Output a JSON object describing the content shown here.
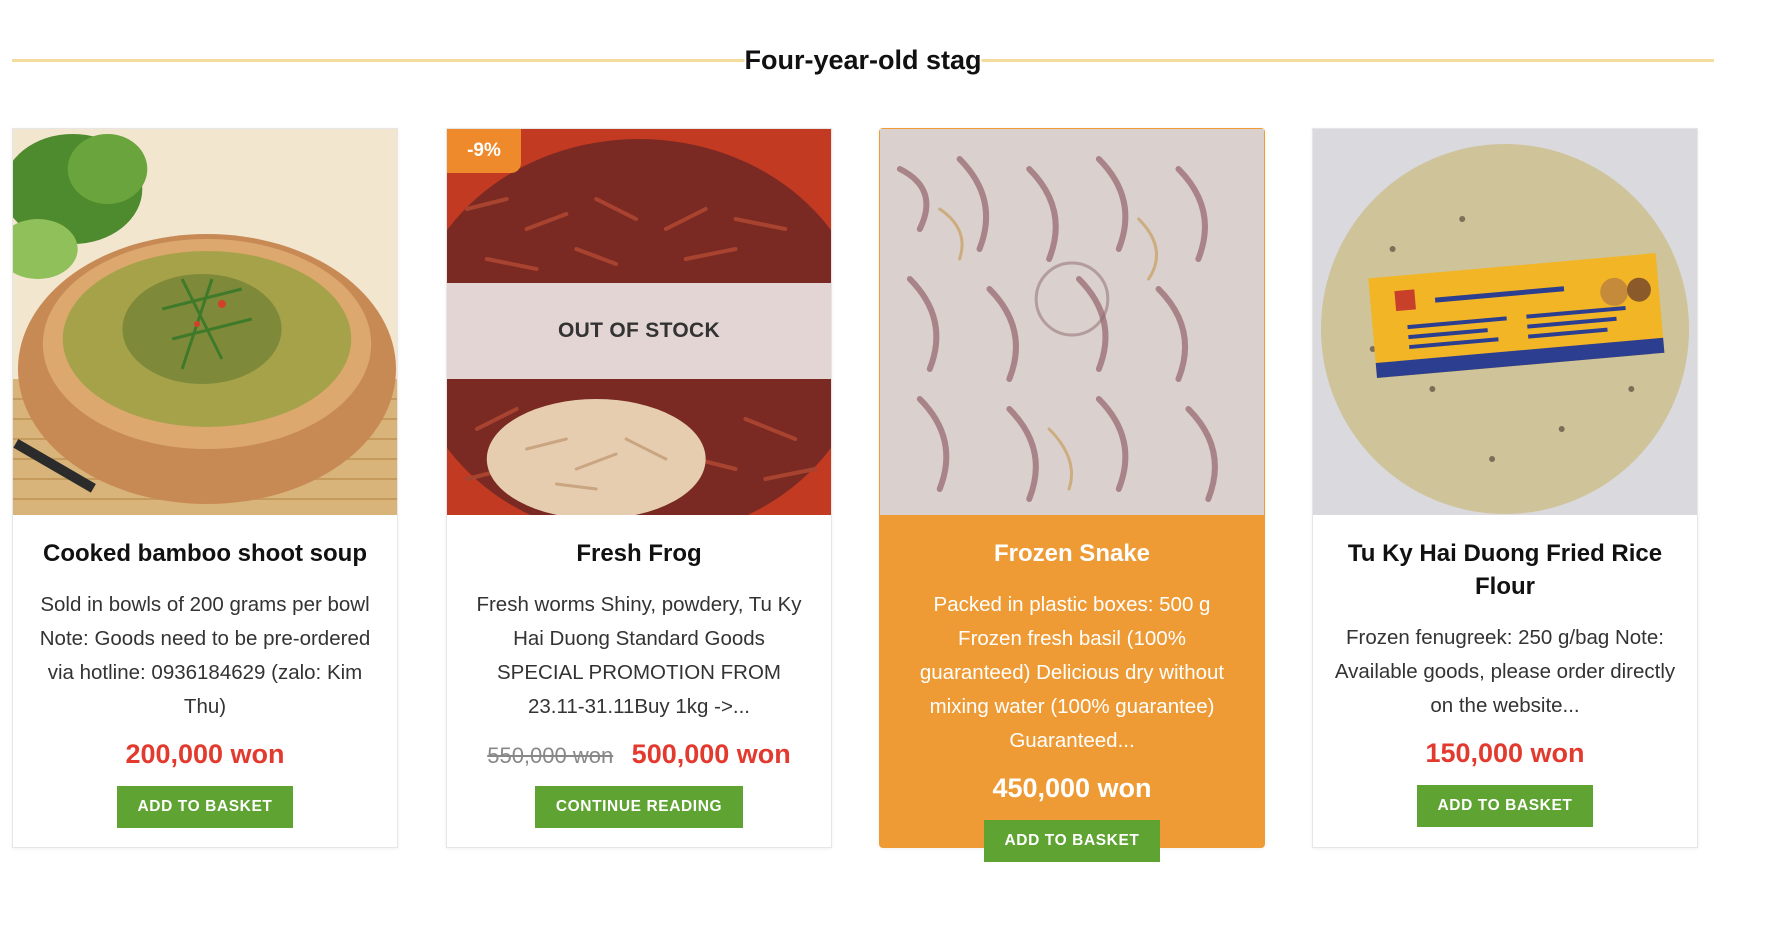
{
  "section": {
    "title": "Four-year-old stag"
  },
  "products": [
    {
      "name": "Cooked bamboo shoot soup",
      "description": "Sold in bowls of 200 grams per bowl Note: Goods need to be pre-ordered via hotline: 0936184629 (zalo: Kim Thu)",
      "old_price": "",
      "price": "200,000 won",
      "button": "ADD TO BASKET",
      "badge": "",
      "overlay": ""
    },
    {
      "name": "Fresh Frog",
      "description": "Fresh worms Shiny, powdery, Tu Ky Hai Duong Standard Goods SPECIAL PROMOTION FROM 23.11-31.11Buy 1kg ->...",
      "old_price": "550,000 won",
      "price": "500,000 won",
      "button": "CONTINUE READING",
      "badge": "-9%",
      "overlay": "OUT OF STOCK"
    },
    {
      "name": "Frozen Snake",
      "description": "Packed in plastic boxes: 500 g Frozen fresh basil (100% guaranteed) Delicious dry without mixing water (100% guarantee) Guaranteed...",
      "old_price": "",
      "price": "450,000 won",
      "button": "ADD TO BASKET",
      "badge": "",
      "overlay": ""
    },
    {
      "name": "Tu Ky Hai Duong Fried Rice Flour",
      "description": "Frozen fenugreek: 250 g/bag Note: Available goods, please order directly on the website...",
      "old_price": "",
      "price": "150,000 won",
      "button": "ADD TO BASKET",
      "badge": "",
      "overlay": ""
    }
  ],
  "colors": {
    "accent_orange": "#ef9b35",
    "price_red": "#e23a2e",
    "button_green": "#5fa332",
    "heading_line": "#f4dc9e"
  }
}
